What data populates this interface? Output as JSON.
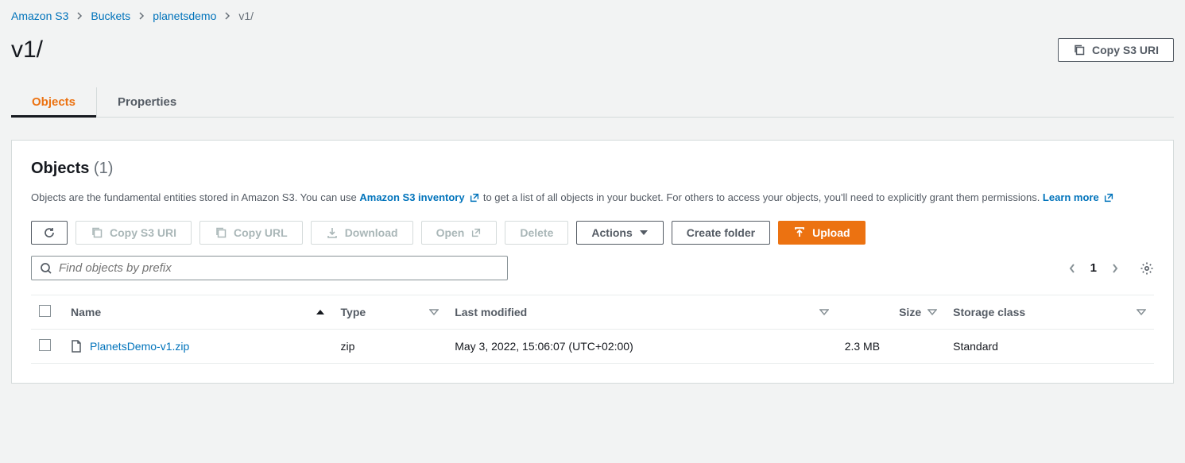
{
  "breadcrumb": {
    "items": [
      "Amazon S3",
      "Buckets",
      "planetsdemo"
    ],
    "current": "v1/"
  },
  "header": {
    "title": "v1/",
    "copy_uri_label": "Copy S3 URI"
  },
  "tabs": {
    "objects": "Objects",
    "properties": "Properties"
  },
  "panel": {
    "title": "Objects",
    "count": "(1)",
    "desc_1": "Objects are the fundamental entities stored in Amazon S3. You can use ",
    "inventory_link": "Amazon S3 inventory",
    "desc_2": " to get a list of all objects in your bucket. For others to access your objects, you'll need to explicitly grant them permissions. ",
    "learn_more": "Learn more"
  },
  "toolbar": {
    "copy_uri": "Copy S3 URI",
    "copy_url": "Copy URL",
    "download": "Download",
    "open": "Open",
    "delete": "Delete",
    "actions": "Actions",
    "create_folder": "Create folder",
    "upload": "Upload"
  },
  "search": {
    "placeholder": "Find objects by prefix"
  },
  "pagination": {
    "page": "1"
  },
  "table": {
    "headers": {
      "name": "Name",
      "type": "Type",
      "last_modified": "Last modified",
      "size": "Size",
      "storage_class": "Storage class"
    },
    "rows": [
      {
        "name": "PlanetsDemo-v1.zip",
        "type": "zip",
        "last_modified": "May 3, 2022, 15:06:07 (UTC+02:00)",
        "size": "2.3 MB",
        "storage_class": "Standard"
      }
    ]
  }
}
